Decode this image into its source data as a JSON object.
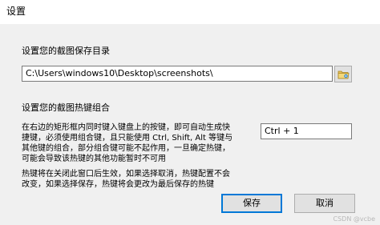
{
  "window": {
    "title": "设置"
  },
  "save_dir": {
    "label": "设置您的截图保存目录",
    "path": "C:\\Users\\windows10\\Desktop\\screenshots\\",
    "browse_icon": "folder-icon"
  },
  "hotkey": {
    "label": "设置您的截图热键组合",
    "description_lines": [
      "在右边的矩形框内同时键入键盘上的按键，即可自动生成快",
      "捷键，必须使用组合键，且只能使用 Ctrl, Shift, Alt 等键与",
      "其他键的组合，部分组合键可能不起作用，一旦确定热键，",
      "可能会导致该热键的其他功能暂时不可用"
    ],
    "value": "Ctrl + 1"
  },
  "note_lines": [
    "热键将在关闭此窗口后生效，如果选择取消，热键配置不会",
    "改变，如果选择保存，热键将会更改为最后保存的热键"
  ],
  "buttons": {
    "save": "保存",
    "cancel": "取消"
  },
  "watermark": "CSDN @vcbe",
  "colors": {
    "client_bg": "#f0f0f0",
    "default_button_border": "#0078d7"
  }
}
